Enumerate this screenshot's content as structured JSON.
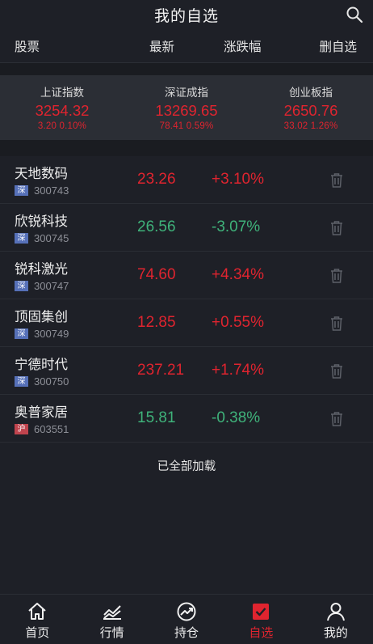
{
  "header": {
    "title": "我的自选"
  },
  "columns": {
    "name": "股票",
    "price": "最新",
    "change": "涨跌幅",
    "remove": "删自选"
  },
  "indices": [
    {
      "name": "上证指数",
      "value": "3254.32",
      "change": "3.20 0.10%"
    },
    {
      "name": "深证成指",
      "value": "13269.65",
      "change": "78.41 0.59%"
    },
    {
      "name": "创业板指",
      "value": "2650.76",
      "change": "33.02 1.26%"
    }
  ],
  "stocks": [
    {
      "name": "天地数码",
      "market": "深",
      "code": "300743",
      "price": "23.26",
      "change": "+3.10%"
    },
    {
      "name": "欣锐科技",
      "market": "深",
      "code": "300745",
      "price": "26.56",
      "change": "-3.07%"
    },
    {
      "name": "锐科激光",
      "market": "深",
      "code": "300747",
      "price": "74.60",
      "change": "+4.34%"
    },
    {
      "name": "顶固集创",
      "market": "深",
      "code": "300749",
      "price": "12.85",
      "change": "+0.55%"
    },
    {
      "name": "宁德时代",
      "market": "深",
      "code": "300750",
      "price": "237.21",
      "change": "+1.74%"
    },
    {
      "name": "奥普家居",
      "market": "沪",
      "code": "603551",
      "price": "15.81",
      "change": "-0.38%"
    }
  ],
  "footer": {
    "loaded": "已全部加载"
  },
  "tabs": [
    {
      "label": "首页",
      "icon": "home-icon"
    },
    {
      "label": "行情",
      "icon": "chart-icon"
    },
    {
      "label": "持仓",
      "icon": "gauge-icon"
    },
    {
      "label": "自选",
      "icon": "checkbox-icon"
    },
    {
      "label": "我的",
      "icon": "user-icon"
    }
  ],
  "colors": {
    "up": "#e0242f",
    "down": "#3fb27a",
    "bg": "#1e2027",
    "accent": "#e0242f"
  }
}
